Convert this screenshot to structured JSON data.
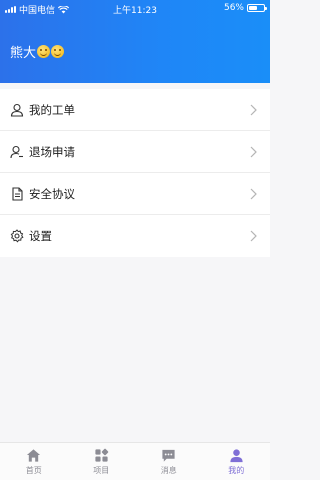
{
  "status_bar": {
    "carrier": "中国电信",
    "time": "上午11:23",
    "battery_text": "56%",
    "battery_level": 0.56
  },
  "profile": {
    "name": "熊大"
  },
  "menu": {
    "items": [
      {
        "label": "我的工单",
        "icon": "user-icon"
      },
      {
        "label": "退场申请",
        "icon": "user-exit-icon"
      },
      {
        "label": "安全协议",
        "icon": "document-icon"
      },
      {
        "label": "设置",
        "icon": "gear-icon"
      }
    ]
  },
  "tabbar": {
    "tabs": [
      {
        "label": "首页",
        "icon": "home-icon"
      },
      {
        "label": "项目",
        "icon": "grid-icon"
      },
      {
        "label": "消息",
        "icon": "message-icon"
      },
      {
        "label": "我的",
        "icon": "person-icon"
      }
    ],
    "active_index": 3,
    "active_color": "#7f6fd6",
    "inactive_color": "#8c8c94"
  },
  "colors": {
    "header_start": "#2c71ea",
    "header_end": "#1a8ef8"
  }
}
